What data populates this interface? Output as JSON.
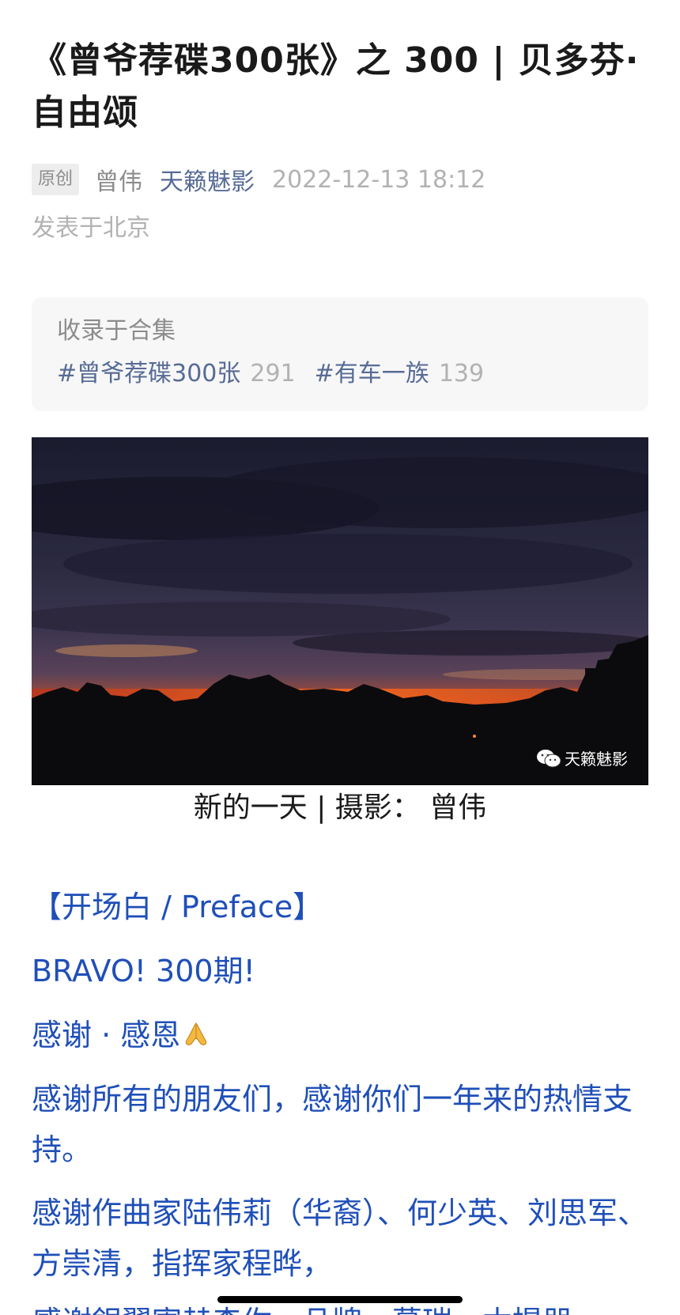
{
  "article": {
    "title": "《曾爷荐碟300张》之 300 | 贝多芬·自由颂",
    "original_badge": "原创",
    "author": "曾伟",
    "account": "天籁魅影",
    "publish_time": "2022-12-13 18:12",
    "location": "发表于北京"
  },
  "collection": {
    "label": "收录于合集",
    "tags": [
      {
        "name": "#曾爷荐碟300张",
        "count": "291"
      },
      {
        "name": "#有车一族",
        "count": "139"
      }
    ]
  },
  "photo": {
    "watermark": "天籁魅影",
    "caption": "新的一天 | 摄影： 曾伟"
  },
  "body": {
    "preface": "【开场白 / Preface】",
    "bravo": "BRAVO! 300期!",
    "thanks": "感谢 · 感恩",
    "friends": "感谢所有的朋友们，感谢你们一年来的热情支持。",
    "composer": "感谢作曲家陆伟莉（华裔）、何少英、刘思军、方崇清，指挥家程晔，",
    "cut_line": "感谢銀翼寄赫森你、品牌、慕瑞、木提器"
  },
  "colors": {
    "link": "#576b95",
    "body_text": "#1f4fb8",
    "meta_gray": "#b2b2b2"
  }
}
